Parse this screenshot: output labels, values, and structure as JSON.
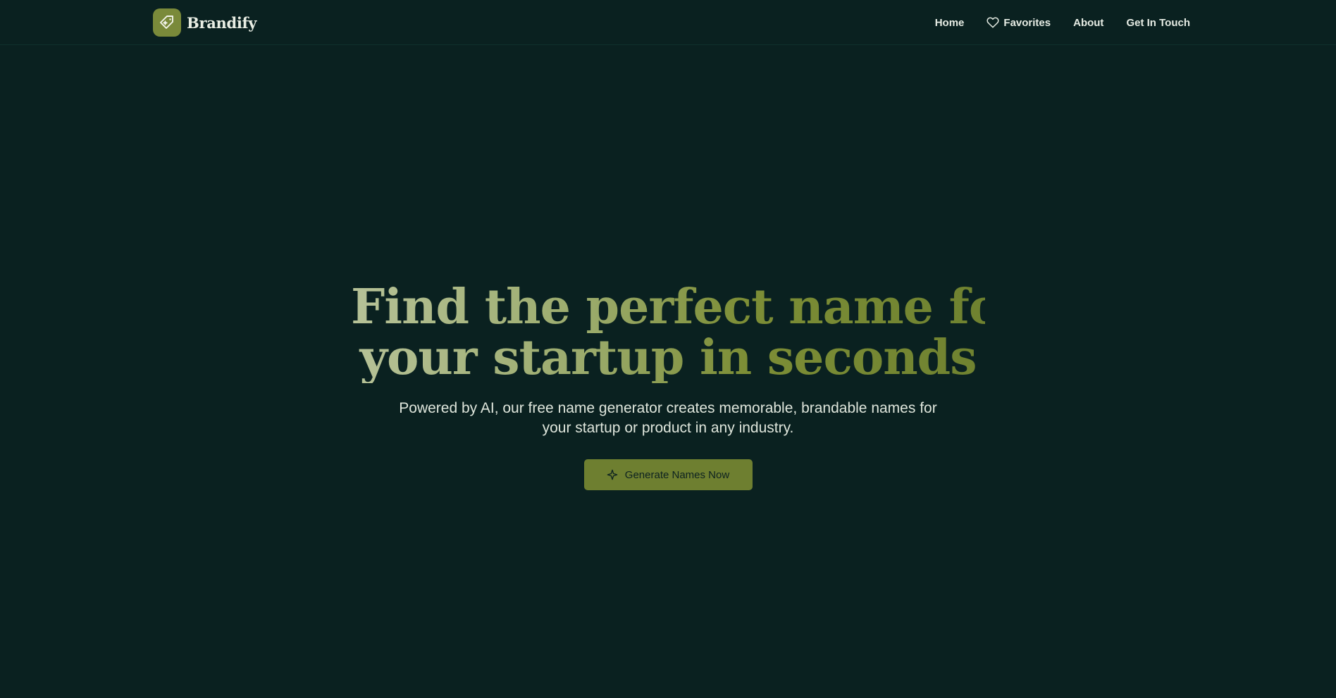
{
  "header": {
    "brand_name": "Brandify",
    "logo_icon": "tag-sparkle-icon",
    "nav": [
      {
        "label": "Home"
      },
      {
        "label": "Favorites",
        "icon": "heart-icon"
      },
      {
        "label": "About"
      },
      {
        "label": "Get In Touch"
      }
    ]
  },
  "hero": {
    "title_line1": "Find the perfect name for",
    "title_line2": "your startup in seconds",
    "subtitle": "Powered by AI, our free name generator creates memorable, brandable names for your startup or product in any industry.",
    "cta_label": "Generate Names Now",
    "cta_icon": "sparkle-icon"
  },
  "colors": {
    "background": "#0a2120",
    "accent": "#6e7f30",
    "logo_bg": "#7a8a3a",
    "title_gradient_start": "#b6c298",
    "title_gradient_end": "#6f8230",
    "text": "#e6ece4"
  }
}
